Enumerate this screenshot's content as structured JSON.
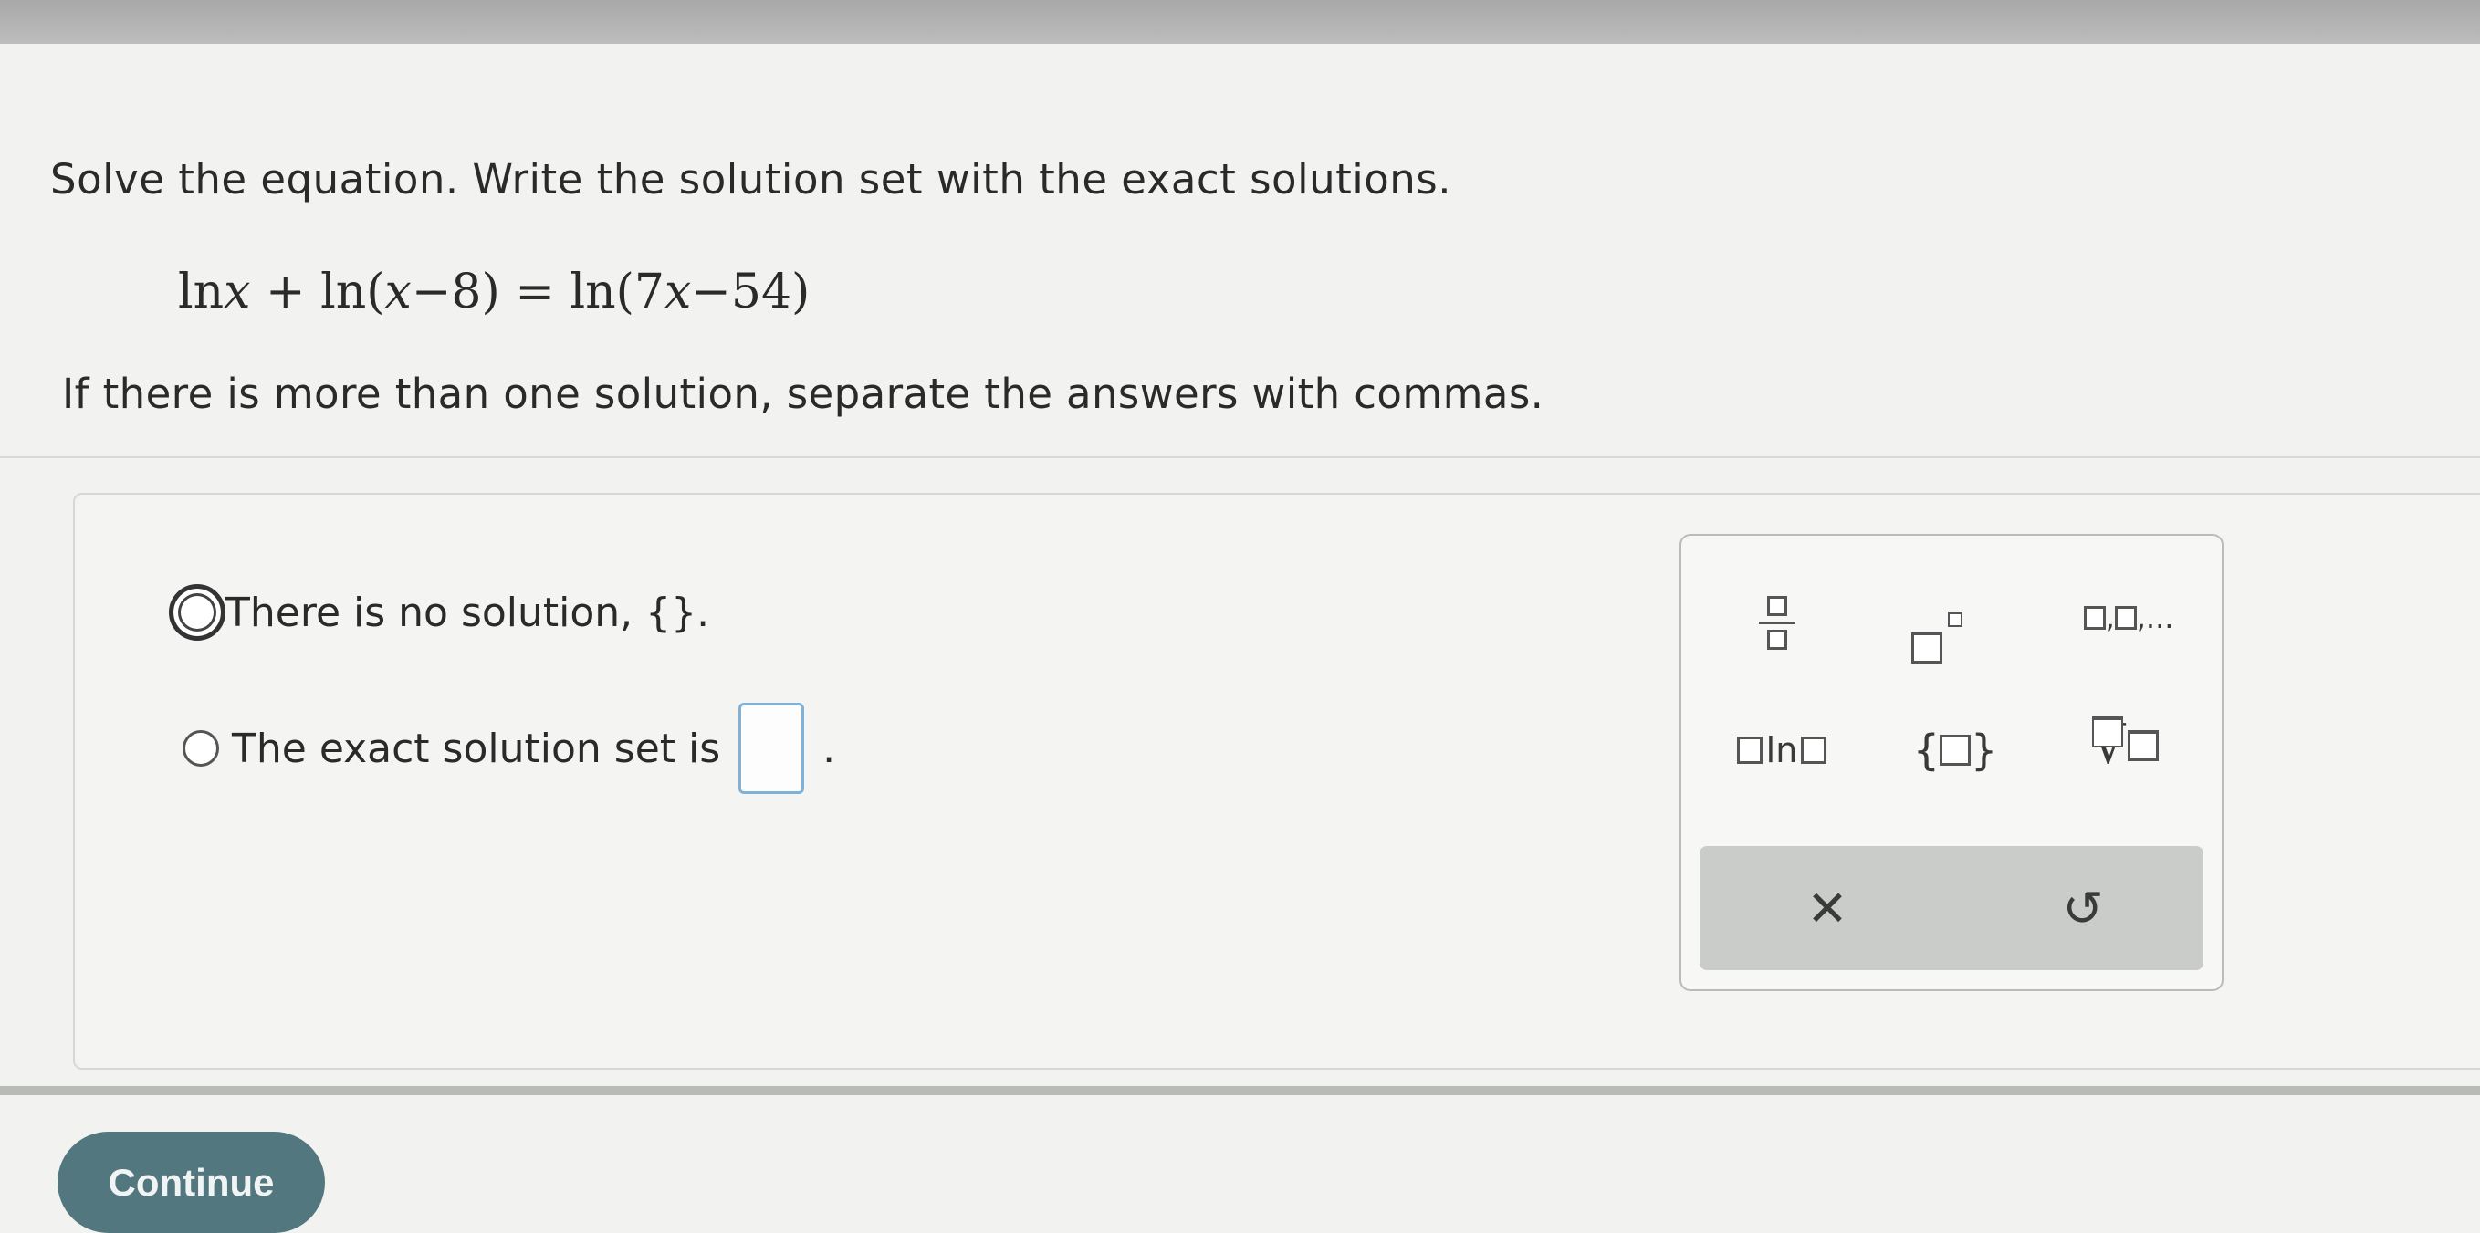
{
  "question": {
    "instruction": "Solve the equation. Write the solution set with the exact solutions.",
    "equation": {
      "ln1": "ln",
      "x1": "x",
      "plus": "+",
      "ln2": "ln",
      "open1": "(",
      "x2": "x",
      "minus1": "−",
      "n8": "8",
      "close1": ")",
      "equals": "=",
      "ln3": "ln",
      "open2": "(",
      "seven": "7",
      "x3": "x",
      "minus2": "−",
      "n54": "54",
      "close2": ")"
    },
    "hint": "If there is more than one solution, separate the answers with commas."
  },
  "options": {
    "no_solution": "There is no solution, {}.",
    "exact_set": "The exact solution set is",
    "exact_set_end": ".",
    "selected": "no_solution"
  },
  "keypad": {
    "list_sep": ",",
    "list_ellipsis": ",...",
    "log_label": "ln",
    "set_open": "{",
    "set_close": "}",
    "root_symbol": "√",
    "clear_symbol": "✕",
    "undo_symbol": "↺"
  },
  "continue_label": "Continue"
}
